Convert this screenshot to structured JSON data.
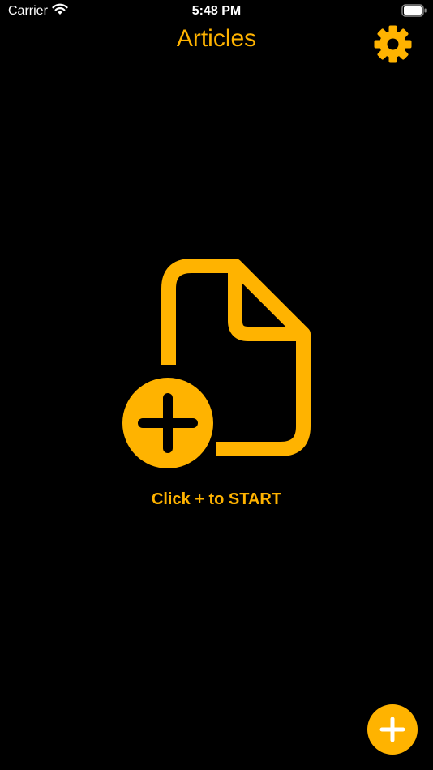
{
  "status_bar": {
    "carrier": "Carrier",
    "time": "5:48 PM"
  },
  "nav": {
    "title": "Articles",
    "settings_icon": "gear-icon"
  },
  "empty_state": {
    "icon": "document-add-icon",
    "message": "Click + to START"
  },
  "fab": {
    "icon": "plus-icon"
  },
  "colors": {
    "accent": "#ffb300",
    "background": "#000000"
  }
}
